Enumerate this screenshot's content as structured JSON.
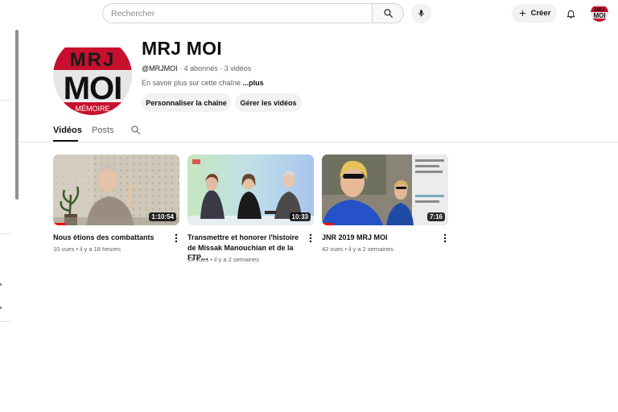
{
  "header": {
    "search_placeholder": "Rechercher",
    "create_label": "Créer"
  },
  "channel": {
    "name": "MRJ MOI",
    "handle": "@MRJMOI",
    "subscribers": "4 abonnés",
    "videos_count": "3 vidéos",
    "about_text": "En savoir plus sur cette chaîne",
    "about_more": "...plus",
    "logo_text_top": "MRJ",
    "logo_text_main": "MOI",
    "logo_text_band": "MÉMOIRE"
  },
  "actions": {
    "customize_label": "Personnaliser la chaîne",
    "manage_label": "Gérer les vidéos"
  },
  "tabs": [
    {
      "label": "Vidéos",
      "active": true
    },
    {
      "label": "Posts",
      "active": false
    }
  ],
  "videos": [
    {
      "title": "Nous étions des combattants",
      "views": "10 vues",
      "age": "il y a 18 heures",
      "duration": "1:10:54"
    },
    {
      "title": "Transmettre et honorer l'histoire de Missak Manouchian et de la FTP…",
      "views": "14 vues",
      "age": "il y a 2 semaines",
      "duration": "10:33"
    },
    {
      "title": "JNR 2019 MRJ MOI",
      "views": "42 vues",
      "age": "il y a 2 semaines",
      "duration": "7:16"
    }
  ],
  "icons": {
    "search": "search-icon",
    "mic": "mic-icon",
    "create": "plus-icon",
    "bell": "bell-icon",
    "more": "more-vert-icon"
  },
  "colors": {
    "brand_red": "#c8102e",
    "progress_red": "#ff0000",
    "pill_bg": "#f2f2f2",
    "text_secondary": "#606060"
  }
}
